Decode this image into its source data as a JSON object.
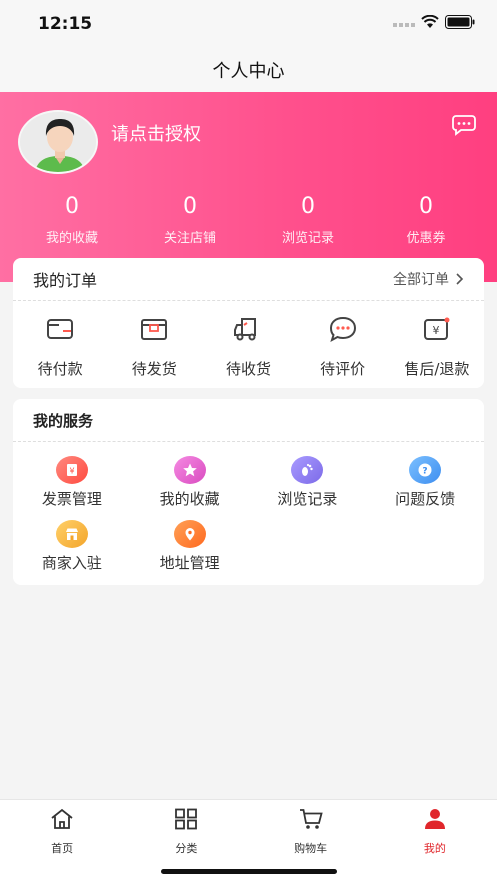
{
  "status_bar": {
    "time": "12:15"
  },
  "nav": {
    "title": "个人中心"
  },
  "profile": {
    "auth_prompt": "请点击授权"
  },
  "stats": [
    {
      "value": "0",
      "label": "我的收藏"
    },
    {
      "value": "0",
      "label": "关注店铺"
    },
    {
      "value": "0",
      "label": "浏览记录"
    },
    {
      "value": "0",
      "label": "优惠券"
    }
  ],
  "orders": {
    "title": "我的订单",
    "all_label": "全部订单",
    "items": [
      {
        "label": "待付款",
        "icon": "wallet-icon"
      },
      {
        "label": "待发货",
        "icon": "package-icon"
      },
      {
        "label": "待收货",
        "icon": "truck-icon"
      },
      {
        "label": "待评价",
        "icon": "chat-bubble-icon"
      },
      {
        "label": "售后/退款",
        "icon": "refund-icon"
      }
    ]
  },
  "services": {
    "title": "我的服务",
    "items": [
      {
        "label": "发票管理",
        "icon": "invoice-icon",
        "color": "#ff5a4f"
      },
      {
        "label": "我的收藏",
        "icon": "star-icon",
        "color": "#e85fd0"
      },
      {
        "label": "浏览记录",
        "icon": "footprint-icon",
        "color": "#8b7bf0"
      },
      {
        "label": "问题反馈",
        "icon": "question-icon",
        "color": "#4a9bf5"
      },
      {
        "label": "商家入驻",
        "icon": "store-icon",
        "color": "#f5b43a"
      },
      {
        "label": "地址管理",
        "icon": "location-icon",
        "color": "#ff7a2e"
      }
    ]
  },
  "tabbar": {
    "items": [
      {
        "label": "首页",
        "icon": "home-icon"
      },
      {
        "label": "分类",
        "icon": "grid-icon"
      },
      {
        "label": "购物车",
        "icon": "cart-icon"
      },
      {
        "label": "我的",
        "icon": "user-icon",
        "active": true
      }
    ]
  },
  "colors": {
    "accent": "#ff4f8c",
    "tab_active": "#e0262b"
  }
}
